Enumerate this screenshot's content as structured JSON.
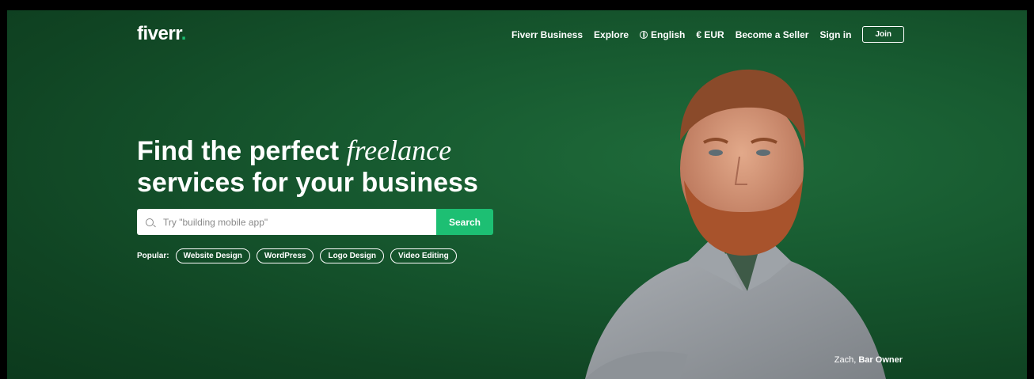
{
  "header": {
    "logo_text": "fiverr",
    "logo_dot": ".",
    "nav": {
      "business": "Fiverr Business",
      "explore": "Explore",
      "language": "English",
      "currency": "€ EUR",
      "become_seller": "Become a Seller",
      "sign_in": "Sign in",
      "join": "Join"
    }
  },
  "hero": {
    "title_line1_prefix": "Find the perfect",
    "title_line1_italic": "freelance",
    "title_line2": "services for your business",
    "search": {
      "placeholder": "Try \"building mobile app\"",
      "value": "",
      "button": "Search"
    },
    "popular": {
      "label": "Popular:",
      "tags": [
        "Website Design",
        "WordPress",
        "Logo Design",
        "Video Editing"
      ]
    },
    "caption": {
      "name": "Zach,",
      "role": "Bar Owner"
    }
  },
  "colors": {
    "brand_green": "#1dbf73",
    "hero_background": "#175a30"
  }
}
